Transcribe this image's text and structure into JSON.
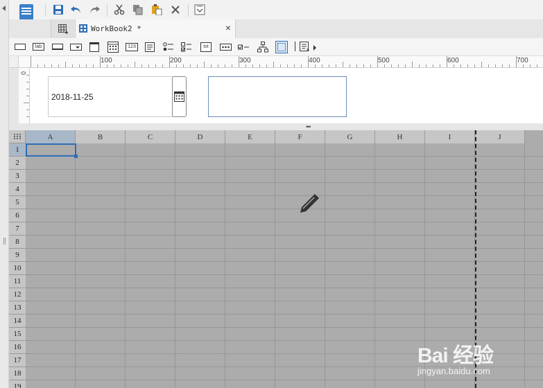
{
  "tab": {
    "title": "WorkBook2 *",
    "close_symbol": "×"
  },
  "ruler": {
    "marks": [
      "100",
      "200",
      "300",
      "400",
      "500",
      "600",
      "700"
    ],
    "left_mark": "0"
  },
  "form": {
    "date_value": "2018-11-25"
  },
  "grid": {
    "columns": [
      "A",
      "B",
      "C",
      "D",
      "E",
      "F",
      "G",
      "H",
      "I",
      "J"
    ],
    "rows": [
      "1",
      "2",
      "3",
      "4",
      "5",
      "6",
      "7",
      "8",
      "9",
      "10",
      "11",
      "12",
      "13",
      "14",
      "15",
      "16",
      "17",
      "18",
      "19"
    ],
    "selected_cell": "A1"
  },
  "watermark": {
    "main": "Bai 经验",
    "sub": "jingyan.baidu.com"
  },
  "colors": {
    "accent": "#2f6db5",
    "grid_bg": "#acacac",
    "header_bg": "#c6c6c6"
  },
  "icons": {
    "toolbar": [
      "save-icon",
      "undo-icon",
      "redo-icon",
      "cut-icon",
      "copy-icon",
      "paste-icon",
      "delete-icon",
      "preview-icon"
    ],
    "widgets": [
      "label-widget-icon",
      "lab-icon",
      "textfield-icon",
      "combobox-icon",
      "date-widget-icon",
      "calendar-widget-icon",
      "number-widget-icon",
      "textarea-icon",
      "radio-group-icon",
      "checkbox-group-icon",
      "txt-icon",
      "password-icon",
      "checkbox-icon",
      "tree-icon",
      "frame-icon",
      "more-widgets-icon"
    ]
  }
}
